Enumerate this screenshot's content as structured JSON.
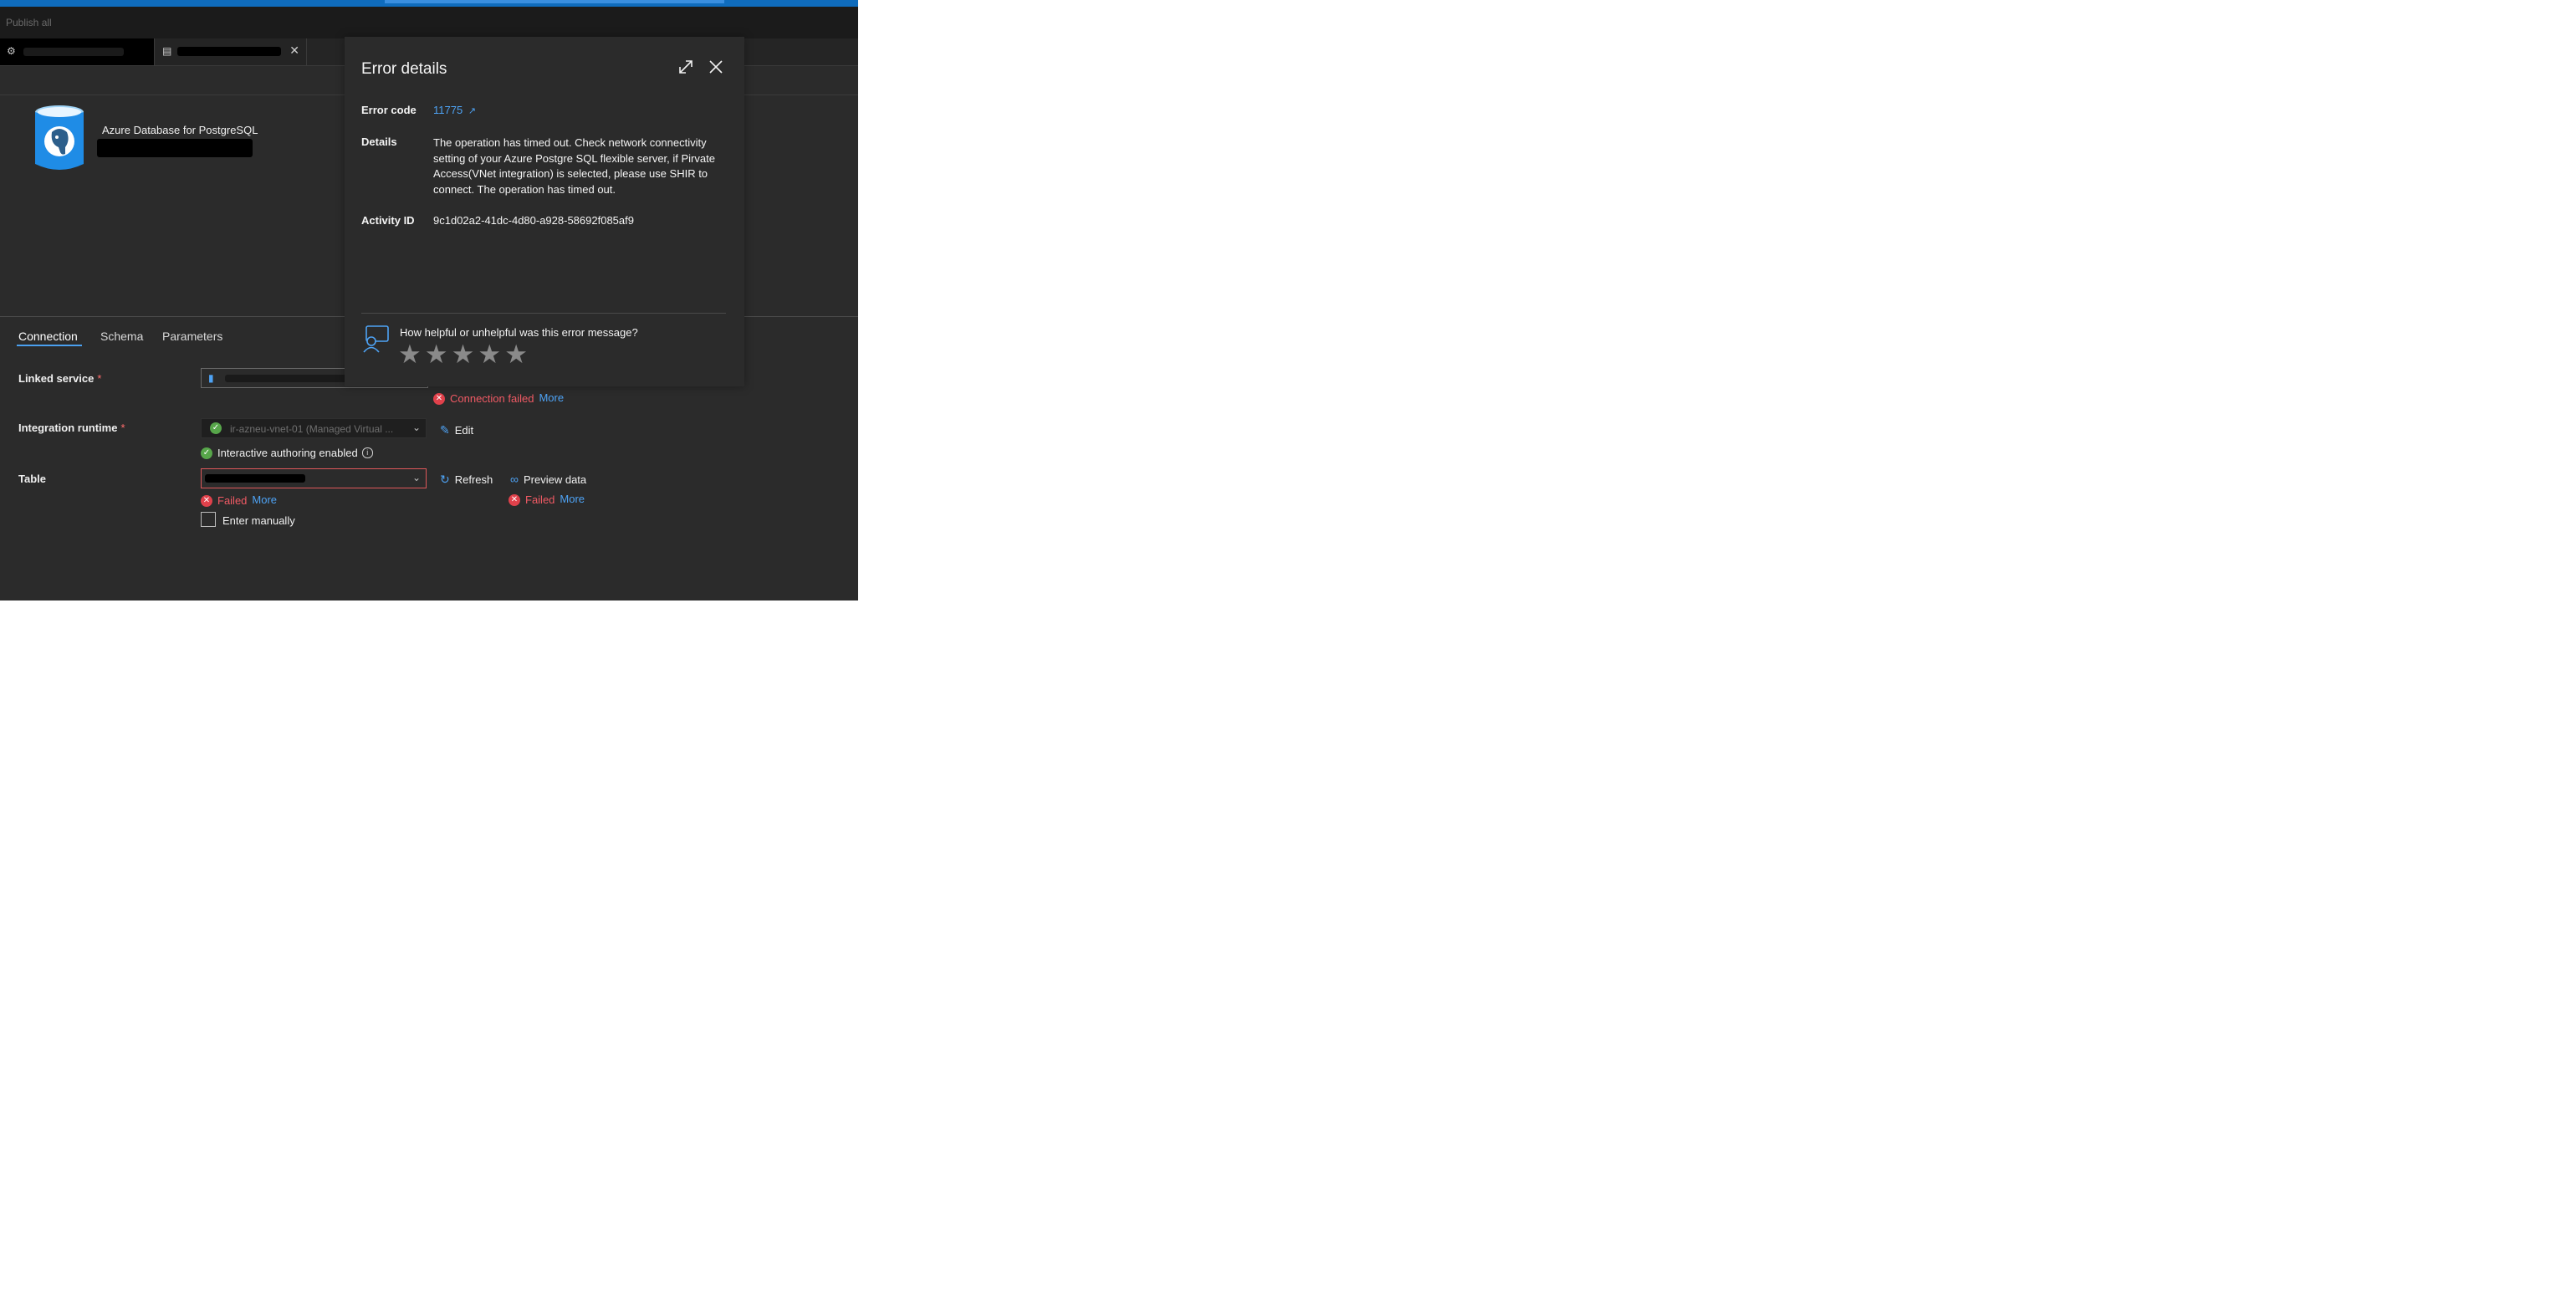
{
  "toolbar": {
    "publish_all": "Publish all"
  },
  "dataset": {
    "type_label": "Azure Database for PostgreSQL"
  },
  "tabs": {
    "connection": "Connection",
    "schema": "Schema",
    "parameters": "Parameters"
  },
  "form": {
    "linked_service_label": "Linked service",
    "integration_runtime_label": "Integration runtime",
    "integration_runtime_value": "ir-azneu-vnet-01 (Managed Virtual ...",
    "table_label": "Table",
    "required_mark": "*",
    "linked_service_status": "Connection failed",
    "linked_service_more": "More",
    "ir_status": "Interactive authoring enabled",
    "edit_label": "Edit",
    "refresh_label": "Refresh",
    "preview_label": "Preview data",
    "table_status": "Failed",
    "table_more": "More",
    "preview_status": "Failed",
    "preview_more": "More",
    "enter_manually": "Enter manually"
  },
  "error_panel": {
    "title": "Error details",
    "error_code_label": "Error code",
    "error_code": "11775",
    "details_label": "Details",
    "details": "The operation has timed out. Check network connectivity setting of your Azure Postgre SQL flexible server, if Pirvate Access(VNet integration) is selected, please use SHIR to connect. The operation has timed out.",
    "activity_id_label": "Activity ID",
    "activity_id": "9c1d02a2-41dc-4d80-a928-58692f085af9",
    "feedback_question": "How helpful or unhelpful was this error message?",
    "rating": 0,
    "rating_max": 5
  },
  "colors": {
    "accent": "#0f6cbd",
    "link": "#4ea3f5",
    "error": "#e0414b",
    "success": "#57a64a",
    "background": "#2b2b2b"
  },
  "icons": [
    "postgresql-icon",
    "expand-icon",
    "close-icon",
    "feedback-icon",
    "star-icon",
    "info-icon",
    "edit-icon",
    "refresh-icon",
    "preview-icon",
    "external-link-icon",
    "error-icon",
    "checkmark-icon",
    "chevron-down-icon"
  ]
}
